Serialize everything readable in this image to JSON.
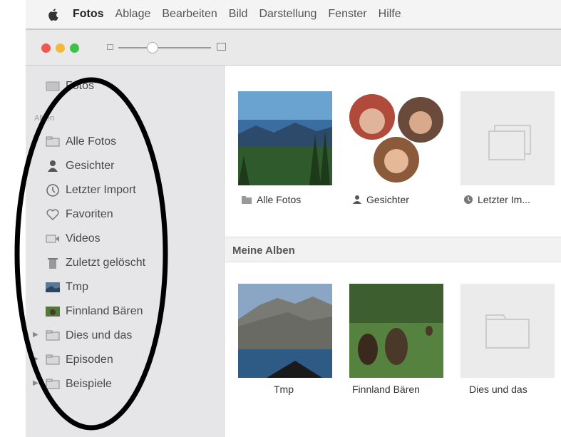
{
  "menubar": {
    "app_name": "Fotos",
    "items": [
      "Ablage",
      "Bearbeiten",
      "Bild",
      "Darstellung",
      "Fenster",
      "Hilfe"
    ]
  },
  "sidebar": {
    "top_item": "Fotos",
    "section_label": "Alben",
    "items": [
      {
        "label": "Alle Fotos",
        "icon": "folder-icon"
      },
      {
        "label": "Gesichter",
        "icon": "person-icon"
      },
      {
        "label": "Letzter Import",
        "icon": "clock-icon"
      },
      {
        "label": "Favoriten",
        "icon": "heart-icon"
      },
      {
        "label": "Videos",
        "icon": "video-icon"
      },
      {
        "label": "Zuletzt gelöscht",
        "icon": "trash-icon"
      },
      {
        "label": "Tmp",
        "icon": "album-thumb-icon"
      },
      {
        "label": "Finnland Bären",
        "icon": "album-thumb-icon"
      },
      {
        "label": "Dies und das",
        "icon": "folder-icon"
      },
      {
        "label": "Episoden",
        "icon": "folder-icon"
      },
      {
        "label": "Beispiele",
        "icon": "folder-icon"
      }
    ]
  },
  "main": {
    "top_albums": [
      {
        "caption": "Alle Fotos",
        "icon": "folder-icon"
      },
      {
        "caption": "Gesichter",
        "icon": "person-icon"
      },
      {
        "caption": "Letzter Im...",
        "icon": "clock-icon"
      }
    ],
    "section_title": "Meine Alben",
    "my_albums": [
      {
        "caption": "Tmp"
      },
      {
        "caption": "Finnland Bären"
      },
      {
        "caption": "Dies und das"
      }
    ]
  },
  "colors": {
    "annotation": "#000000",
    "traffic_red": "#f1574f",
    "traffic_yellow": "#f5b83a",
    "traffic_green": "#40c248"
  }
}
